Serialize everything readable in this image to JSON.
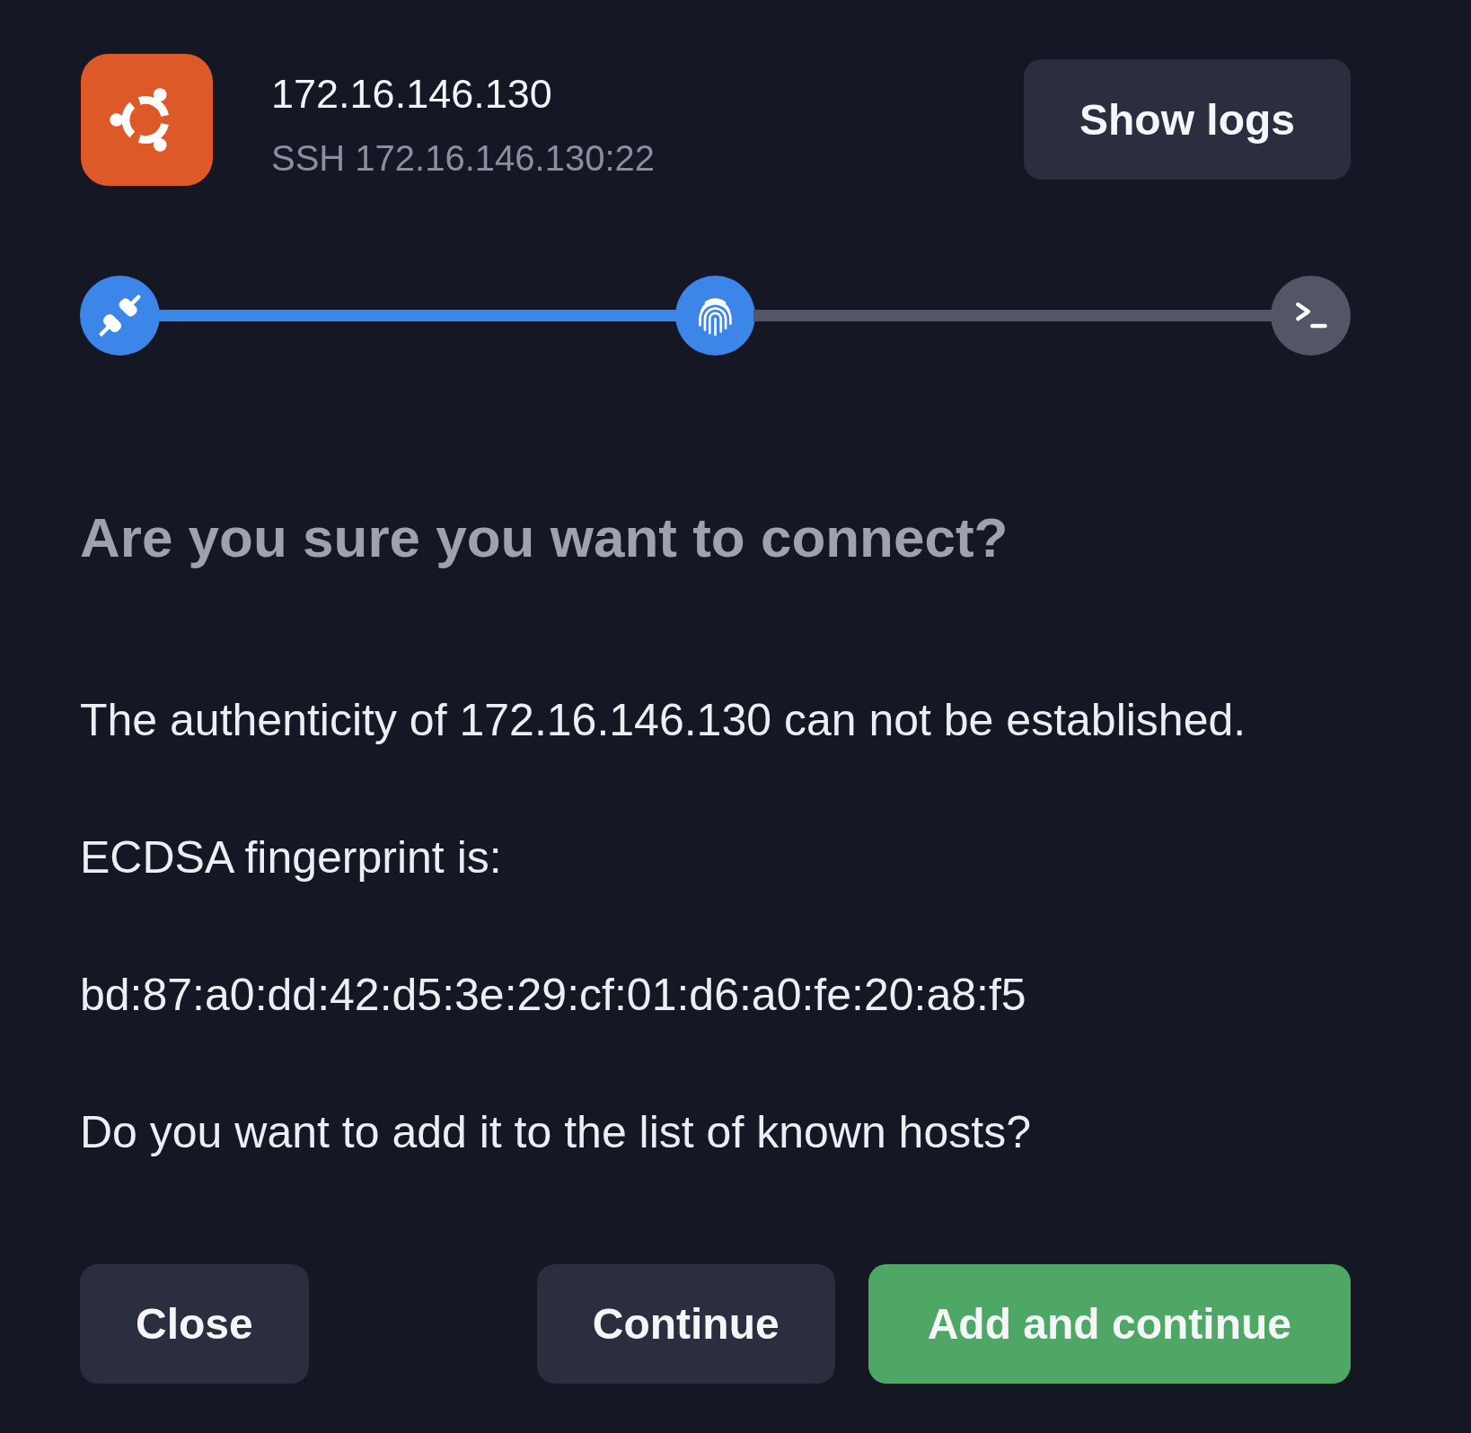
{
  "header": {
    "title": "172.16.146.130",
    "subtitle": "SSH 172.16.146.130:22",
    "logs_button": "Show logs"
  },
  "steps": [
    {
      "kind": "plug",
      "active": true
    },
    {
      "kind": "fingerprint",
      "active": true
    },
    {
      "kind": "terminal",
      "active": false
    }
  ],
  "heading": "Are you sure you want to connect?",
  "body": {
    "message": "The authenticity of 172.16.146.130 can not be established.",
    "fingerprint_label": "ECDSA fingerprint is:",
    "fingerprint": "bd:87:a0:dd:42:d5:3e:29:cf:01:d6:a0:fe:20:a8:f5",
    "question": "Do you want to add it to the list of known hosts?"
  },
  "buttons": [
    {
      "label": "Close",
      "kind": "secondary"
    },
    {
      "label": "Continue",
      "kind": "secondary"
    },
    {
      "label": "Add and continue",
      "kind": "primary"
    }
  ]
}
